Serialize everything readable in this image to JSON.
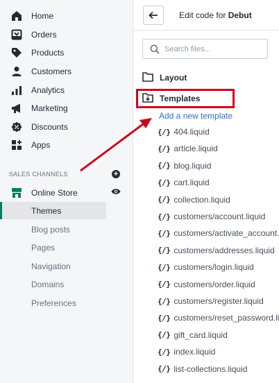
{
  "sidebar": {
    "items": [
      {
        "label": "Home",
        "icon": "home-icon"
      },
      {
        "label": "Orders",
        "icon": "orders-icon"
      },
      {
        "label": "Products",
        "icon": "tag-icon"
      },
      {
        "label": "Customers",
        "icon": "person-icon"
      },
      {
        "label": "Analytics",
        "icon": "bar-chart-icon"
      },
      {
        "label": "Marketing",
        "icon": "megaphone-icon"
      },
      {
        "label": "Discounts",
        "icon": "discount-icon"
      },
      {
        "label": "Apps",
        "icon": "apps-icon"
      }
    ],
    "sales_channels_heading": "SALES CHANNELS",
    "online_store": "Online Store",
    "sub_items": [
      "Themes",
      "Blog posts",
      "Pages",
      "Navigation",
      "Domains",
      "Preferences"
    ]
  },
  "header": {
    "title_prefix": "Edit code for",
    "theme_name": "Debut"
  },
  "search": {
    "placeholder": "Search files..."
  },
  "folders": {
    "layout": "Layout",
    "templates": "Templates"
  },
  "add_template_link": "Add a new template",
  "files": [
    "404.liquid",
    "article.liquid",
    "blog.liquid",
    "cart.liquid",
    "collection.liquid",
    "customers/account.liquid",
    "customers/activate_account.liquid",
    "customers/addresses.liquid",
    "customers/login.liquid",
    "customers/order.liquid",
    "customers/register.liquid",
    "customers/reset_password.liquid",
    "gift_card.liquid",
    "index.liquid",
    "list-collections.liquid"
  ],
  "file_icon_glyph": "{/}",
  "colors": {
    "active_indicator": "#008060",
    "link": "#2c6ecb",
    "annotation_red": "#d0021b"
  }
}
